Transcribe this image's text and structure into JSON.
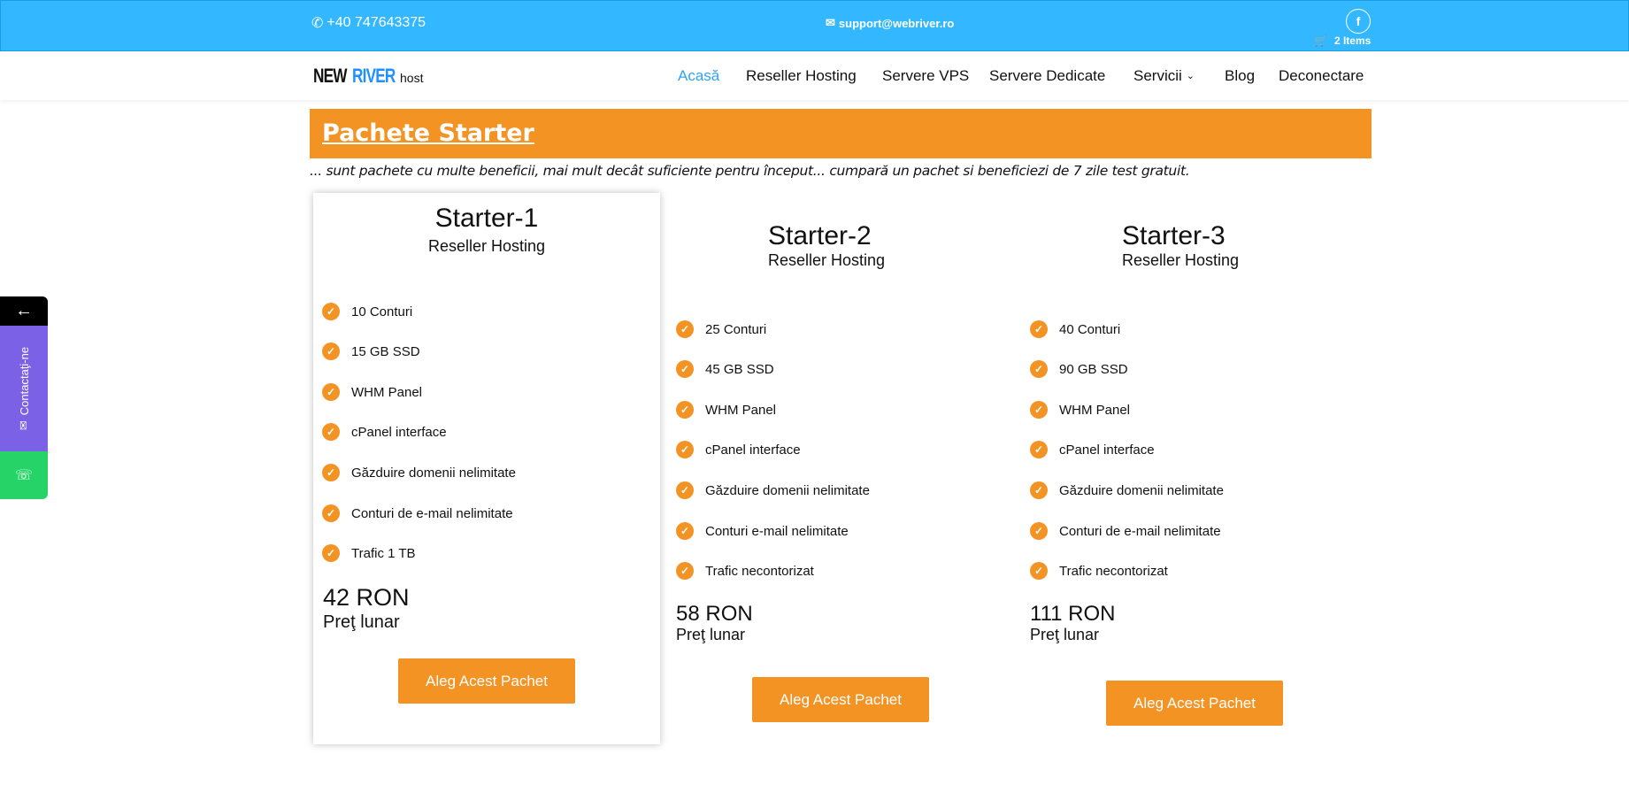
{
  "topbar": {
    "phone": "+40 747643375",
    "email": "support@webriver.ro",
    "facebook_icon": "f",
    "cart": "2 Items",
    "bg_color": "#33b8ff"
  },
  "header": {
    "logo": {
      "new": "NEW",
      "river": "RIVER",
      "host": "host"
    },
    "nav": [
      {
        "label": "Acasă",
        "active": true
      },
      {
        "label": "Reseller Hosting"
      },
      {
        "label": "Servere VPS"
      },
      {
        "label": "Servere Dedicate"
      },
      {
        "label": "Servicii",
        "has_dropdown": true
      },
      {
        "label": "Blog"
      },
      {
        "label": "Deconectare"
      }
    ]
  },
  "banner": {
    "title": "Pachete Starter",
    "subtitle": "... sunt pachete cu multe beneficii, mai mult decât suficiente pentru început... cumpară un pachet si beneficiezi de 7 zile test gratuit."
  },
  "plans": [
    {
      "name": "Starter-1",
      "category": "Reseller Hosting",
      "features": [
        "10 Conturi",
        "15 GB SSD",
        "WHM Panel",
        "cPanel interface",
        "Găzduire domenii nelimitate",
        "Conturi de e-mail nelimitate",
        "Trafic 1 TB"
      ],
      "price": "42 RON",
      "price_label": "Preţ lunar",
      "button": "Aleg Acest Pachet"
    },
    {
      "name": "Starter-2",
      "category": "Reseller Hosting",
      "features": [
        "25 Conturi",
        "45 GB SSD",
        "WHM Panel",
        "cPanel interface",
        "Găzduire domenii nelimitate",
        "Conturi e-mail nelimitate",
        "Trafic necontorizat"
      ],
      "price": "58 RON",
      "price_label": "Preţ lunar",
      "button": "Aleg Acest Pachet"
    },
    {
      "name": "Starter-3",
      "category": "Reseller Hosting",
      "features": [
        "40 Conturi",
        "90 GB SSD",
        "WHM Panel",
        "cPanel interface",
        "Găzduire domenii nelimitate",
        "Conturi de e-mail nelimitate",
        "Trafic necontorizat"
      ],
      "price": "111 RON",
      "price_label": "Preţ lunar",
      "button": "Aleg Acest Pachet"
    }
  ],
  "side": {
    "contact_label": "Contactaţi-ne",
    "arrow_icon": "left-arrow-icon",
    "whatsapp_icon": "whatsapp-icon"
  },
  "colors": {
    "accent": "#f39324",
    "nav_active": "#2ea3f2",
    "side_contact": "#7b61e6",
    "whatsapp": "#25d366"
  }
}
